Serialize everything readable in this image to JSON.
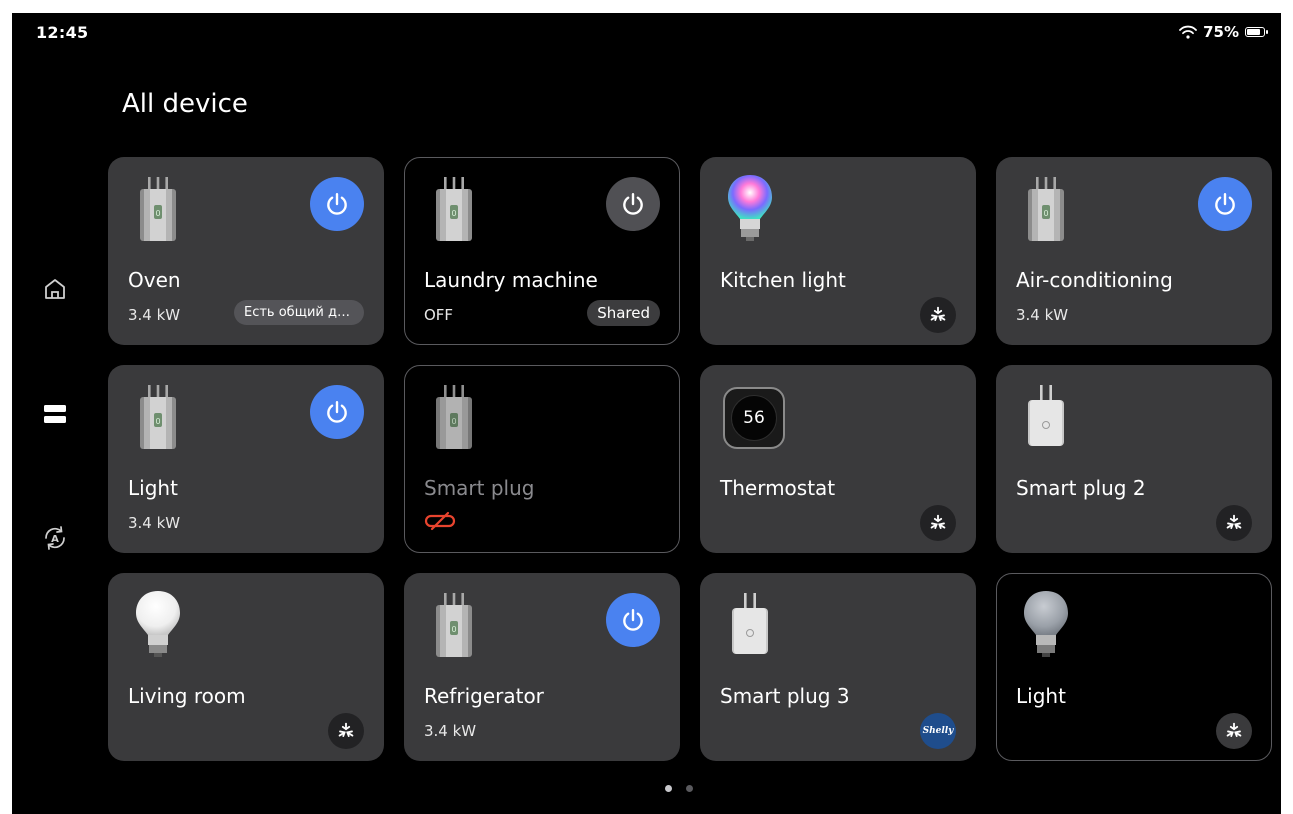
{
  "status": {
    "time": "12:45",
    "battery": "75%"
  },
  "page_title": "All device",
  "sidebar": [
    {
      "icon": "home-icon"
    },
    {
      "icon": "devices-icon"
    },
    {
      "icon": "automation-icon"
    }
  ],
  "devices": [
    {
      "name": "Oven",
      "sub": "3.4 kW",
      "icon": "plug-icon",
      "power": "on",
      "tag": "Есть общий до..."
    },
    {
      "name": "Laundry machine",
      "sub": "OFF",
      "icon": "plug-icon",
      "power": "off",
      "tag": "Shared"
    },
    {
      "name": "Kitchen light",
      "sub": "",
      "icon": "color-bulb-icon",
      "badge": "matter-icon"
    },
    {
      "name": "Air-conditioning",
      "sub": "3.4 kW",
      "icon": "plug-icon",
      "power": "on"
    },
    {
      "name": "Light",
      "sub": "3.4 kW",
      "icon": "plug-icon",
      "power": "on"
    },
    {
      "name": "Smart plug",
      "sub": "",
      "icon": "plug-icon",
      "status": "offline-icon"
    },
    {
      "name": "Thermostat",
      "sub": "",
      "icon": "thermostat-icon",
      "badge": "matter-icon",
      "reading": "56"
    },
    {
      "name": "Smart plug 2",
      "sub": "",
      "icon": "white-plug-icon",
      "badge": "matter-icon"
    },
    {
      "name": "Living room",
      "sub": "",
      "icon": "white-bulb-icon",
      "badge": "matter-icon"
    },
    {
      "name": "Refrigerator",
      "sub": "3.4 kW",
      "icon": "plug-icon",
      "power": "on"
    },
    {
      "name": "Smart plug 3",
      "sub": "",
      "icon": "white-plug-icon",
      "badge": "shelly-icon",
      "badge_text": "Shelly"
    },
    {
      "name": "Light",
      "sub": "",
      "icon": "grey-bulb-icon",
      "badge": "matter-icon"
    }
  ],
  "pager": {
    "pages": 2,
    "current": 1
  },
  "colors": {
    "accent": "#4a82f0",
    "card": "#3a3a3c",
    "offline": "#e8442e"
  }
}
